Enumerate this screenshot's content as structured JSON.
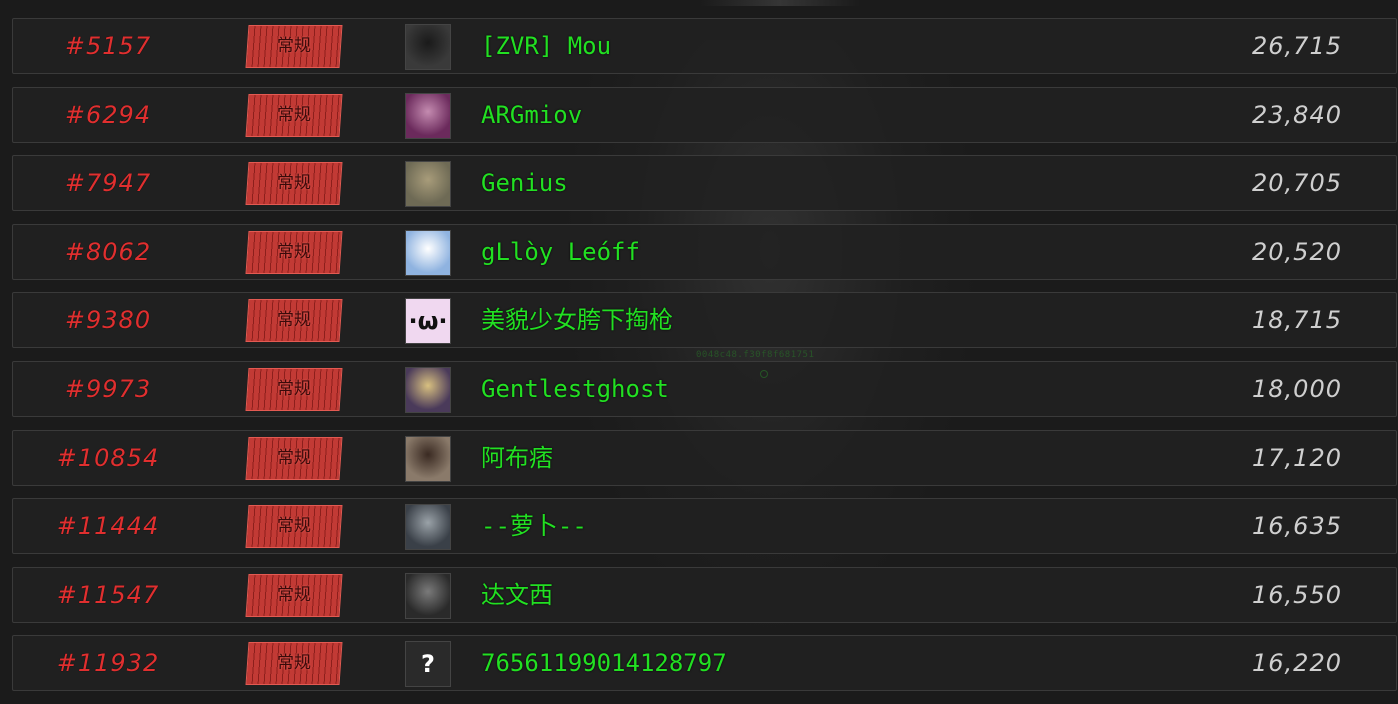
{
  "leaderboard": {
    "badge_label": "常规",
    "rows": [
      {
        "rank": "#5157",
        "name": "[ZVR] Mou",
        "score": "26,715",
        "avatar": {
          "icon": "skull-mask-avatar",
          "bg": "#3a3a3a",
          "fg": "#1a1a1a"
        }
      },
      {
        "rank": "#6294",
        "name": "ARGmiov",
        "score": "23,840",
        "avatar": {
          "icon": "anime-girl-avatar",
          "bg": "#6b2a5c",
          "fg": "#c48bb0"
        }
      },
      {
        "rank": "#7947",
        "name": "Genius",
        "score": "20,705",
        "avatar": {
          "icon": "landscape-avatar",
          "bg": "#6e6a55",
          "fg": "#a89c7a"
        }
      },
      {
        "rank": "#8062",
        "name": "gLlòy Leóff",
        "score": "20,520",
        "avatar": {
          "icon": "anime-character-avatar",
          "bg": "#8fb3e0",
          "fg": "#ffffff"
        }
      },
      {
        "rank": "#9380",
        "name": "美貌少女胯下掏枪",
        "score": "18,715",
        "avatar": {
          "icon": "cute-face-avatar",
          "bg": "#f0d8f0",
          "fg": "#111111",
          "glyph": "·ω·"
        }
      },
      {
        "rank": "#9973",
        "name": "Gentlestghost",
        "score": "18,000",
        "avatar": {
          "icon": "fox-avatar",
          "bg": "#4a3a5a",
          "fg": "#d8c080"
        }
      },
      {
        "rank": "#10854",
        "name": "阿布痞",
        "score": "17,120",
        "avatar": {
          "icon": "person-portrait-avatar",
          "bg": "#8a7a6a",
          "fg": "#3a2a22"
        }
      },
      {
        "rank": "#11444",
        "name": "--萝卜--",
        "score": "16,635",
        "avatar": {
          "icon": "alien-avatar",
          "bg": "#3a4048",
          "fg": "#9aa2a8"
        }
      },
      {
        "rank": "#11547",
        "name": "达文西",
        "score": "16,550",
        "avatar": {
          "icon": "man-portrait-avatar",
          "bg": "#2a2a2a",
          "fg": "#7a7a7a"
        }
      },
      {
        "rank": "#11932",
        "name": "76561199014128797",
        "score": "16,220",
        "avatar": {
          "icon": "unknown-question-avatar",
          "bg": "#2a2a2a",
          "fg": "#ffffff",
          "glyph": "?"
        }
      }
    ]
  },
  "overlay": {
    "watermark": "0048c48.f30f8f681751"
  },
  "colors": {
    "rank": "#e02f2f",
    "name": "#22e022",
    "score": "#cfcfcf",
    "badge": "#c23a35"
  }
}
